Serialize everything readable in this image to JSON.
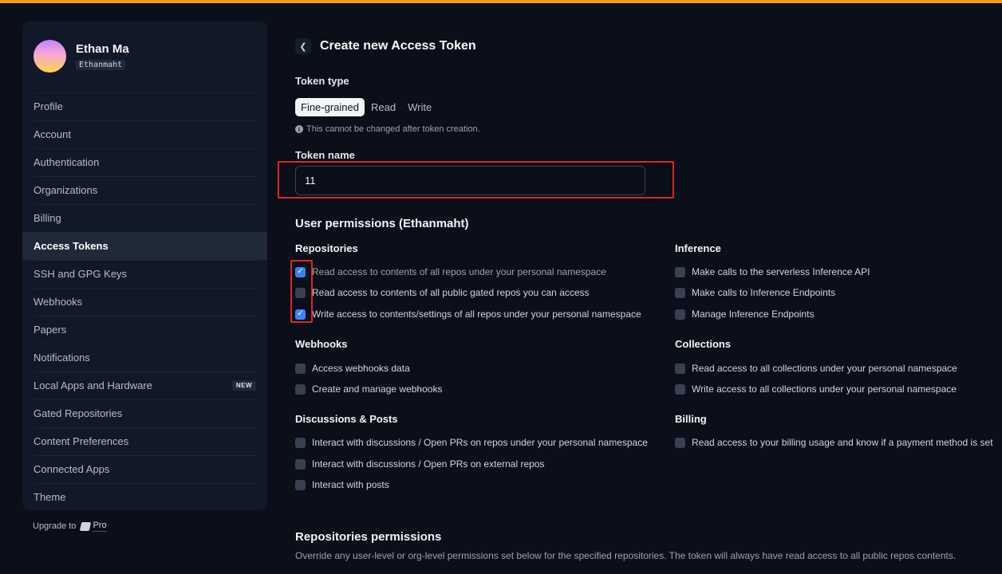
{
  "colors": {
    "accent_bar": "#f59e0b",
    "checkbox_checked": "#3b82f6",
    "highlight_box": "#dc2626"
  },
  "profile": {
    "name": "Ethan Ma",
    "username": "Ethanmaht"
  },
  "sidebar": {
    "items": [
      {
        "label": "Profile"
      },
      {
        "label": "Account"
      },
      {
        "label": "Authentication"
      },
      {
        "label": "Organizations"
      },
      {
        "label": "Billing"
      },
      {
        "label": "Access Tokens",
        "active": true
      },
      {
        "label": "SSH and GPG Keys"
      },
      {
        "label": "Webhooks"
      },
      {
        "label": "Papers"
      },
      {
        "label": "Notifications"
      },
      {
        "label": "Local Apps and Hardware",
        "badge": "NEW"
      },
      {
        "label": "Gated Repositories"
      },
      {
        "label": "Content Preferences"
      },
      {
        "label": "Connected Apps"
      },
      {
        "label": "Theme"
      }
    ],
    "upgrade_label": "Upgrade to",
    "pro_label": "Pro"
  },
  "header": {
    "back_icon": "chevron-left-icon",
    "title": "Create new Access Token"
  },
  "token_type": {
    "label": "Token type",
    "tabs": [
      "Fine-grained",
      "Read",
      "Write"
    ],
    "selected": "Fine-grained",
    "notice": "This cannot be changed after token creation."
  },
  "token_name": {
    "label": "Token name",
    "value": "11"
  },
  "user_permissions": {
    "title": "User permissions (Ethanmaht)",
    "repositories": {
      "title": "Repositories",
      "items": [
        {
          "label": "Read access to contents of all repos under your personal namespace",
          "checked": true
        },
        {
          "label": "Read access to contents of all public gated repos you can access",
          "checked": false
        },
        {
          "label": "Write access to contents/settings of all repos under your personal namespace",
          "checked": true
        }
      ]
    },
    "inference": {
      "title": "Inference",
      "items": [
        {
          "label": "Make calls to the serverless Inference API",
          "checked": false
        },
        {
          "label": "Make calls to Inference Endpoints",
          "checked": false
        },
        {
          "label": "Manage Inference Endpoints",
          "checked": false
        }
      ]
    },
    "webhooks": {
      "title": "Webhooks",
      "items": [
        {
          "label": "Access webhooks data",
          "checked": false
        },
        {
          "label": "Create and manage webhooks",
          "checked": false
        }
      ]
    },
    "collections": {
      "title": "Collections",
      "items": [
        {
          "label": "Read access to all collections under your personal namespace",
          "checked": false
        },
        {
          "label": "Write access to all collections under your personal namespace",
          "checked": false
        }
      ]
    },
    "discussions": {
      "title": "Discussions & Posts",
      "items": [
        {
          "label": "Interact with discussions / Open PRs on repos under your personal namespace",
          "checked": false
        },
        {
          "label": "Interact with discussions / Open PRs on external repos",
          "checked": false
        },
        {
          "label": "Interact with posts",
          "checked": false
        }
      ]
    },
    "billing": {
      "title": "Billing",
      "items": [
        {
          "label": "Read access to your billing usage and know if a payment method is set",
          "checked": false
        }
      ]
    }
  },
  "repo_permissions": {
    "title": "Repositories permissions",
    "description": "Override any user-level or org-level permissions set below for the specified repositories. The token will always have read access to all public repos contents."
  }
}
